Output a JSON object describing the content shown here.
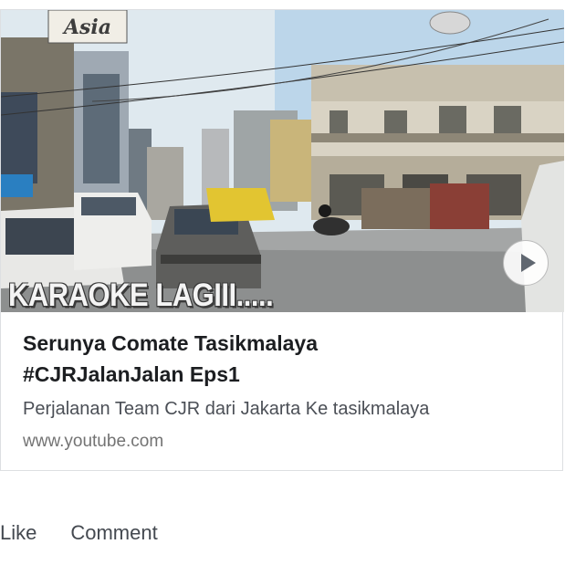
{
  "link_preview": {
    "thumbnail": {
      "alt_icon": "street-scene-image",
      "store_sign": "Asia",
      "overlay_caption": "KARAOKE LAGIII.....",
      "play_icon": "play-icon"
    },
    "title_line1": "Serunya Comate Tasikmalaya",
    "title_line2": "#CJRJalanJalan Eps1",
    "description": "Perjalanan Team CJR dari Jakarta Ke tasikmalaya",
    "domain": "www.youtube.com"
  },
  "actions": {
    "like_label": "Like",
    "comment_label": "Comment"
  }
}
